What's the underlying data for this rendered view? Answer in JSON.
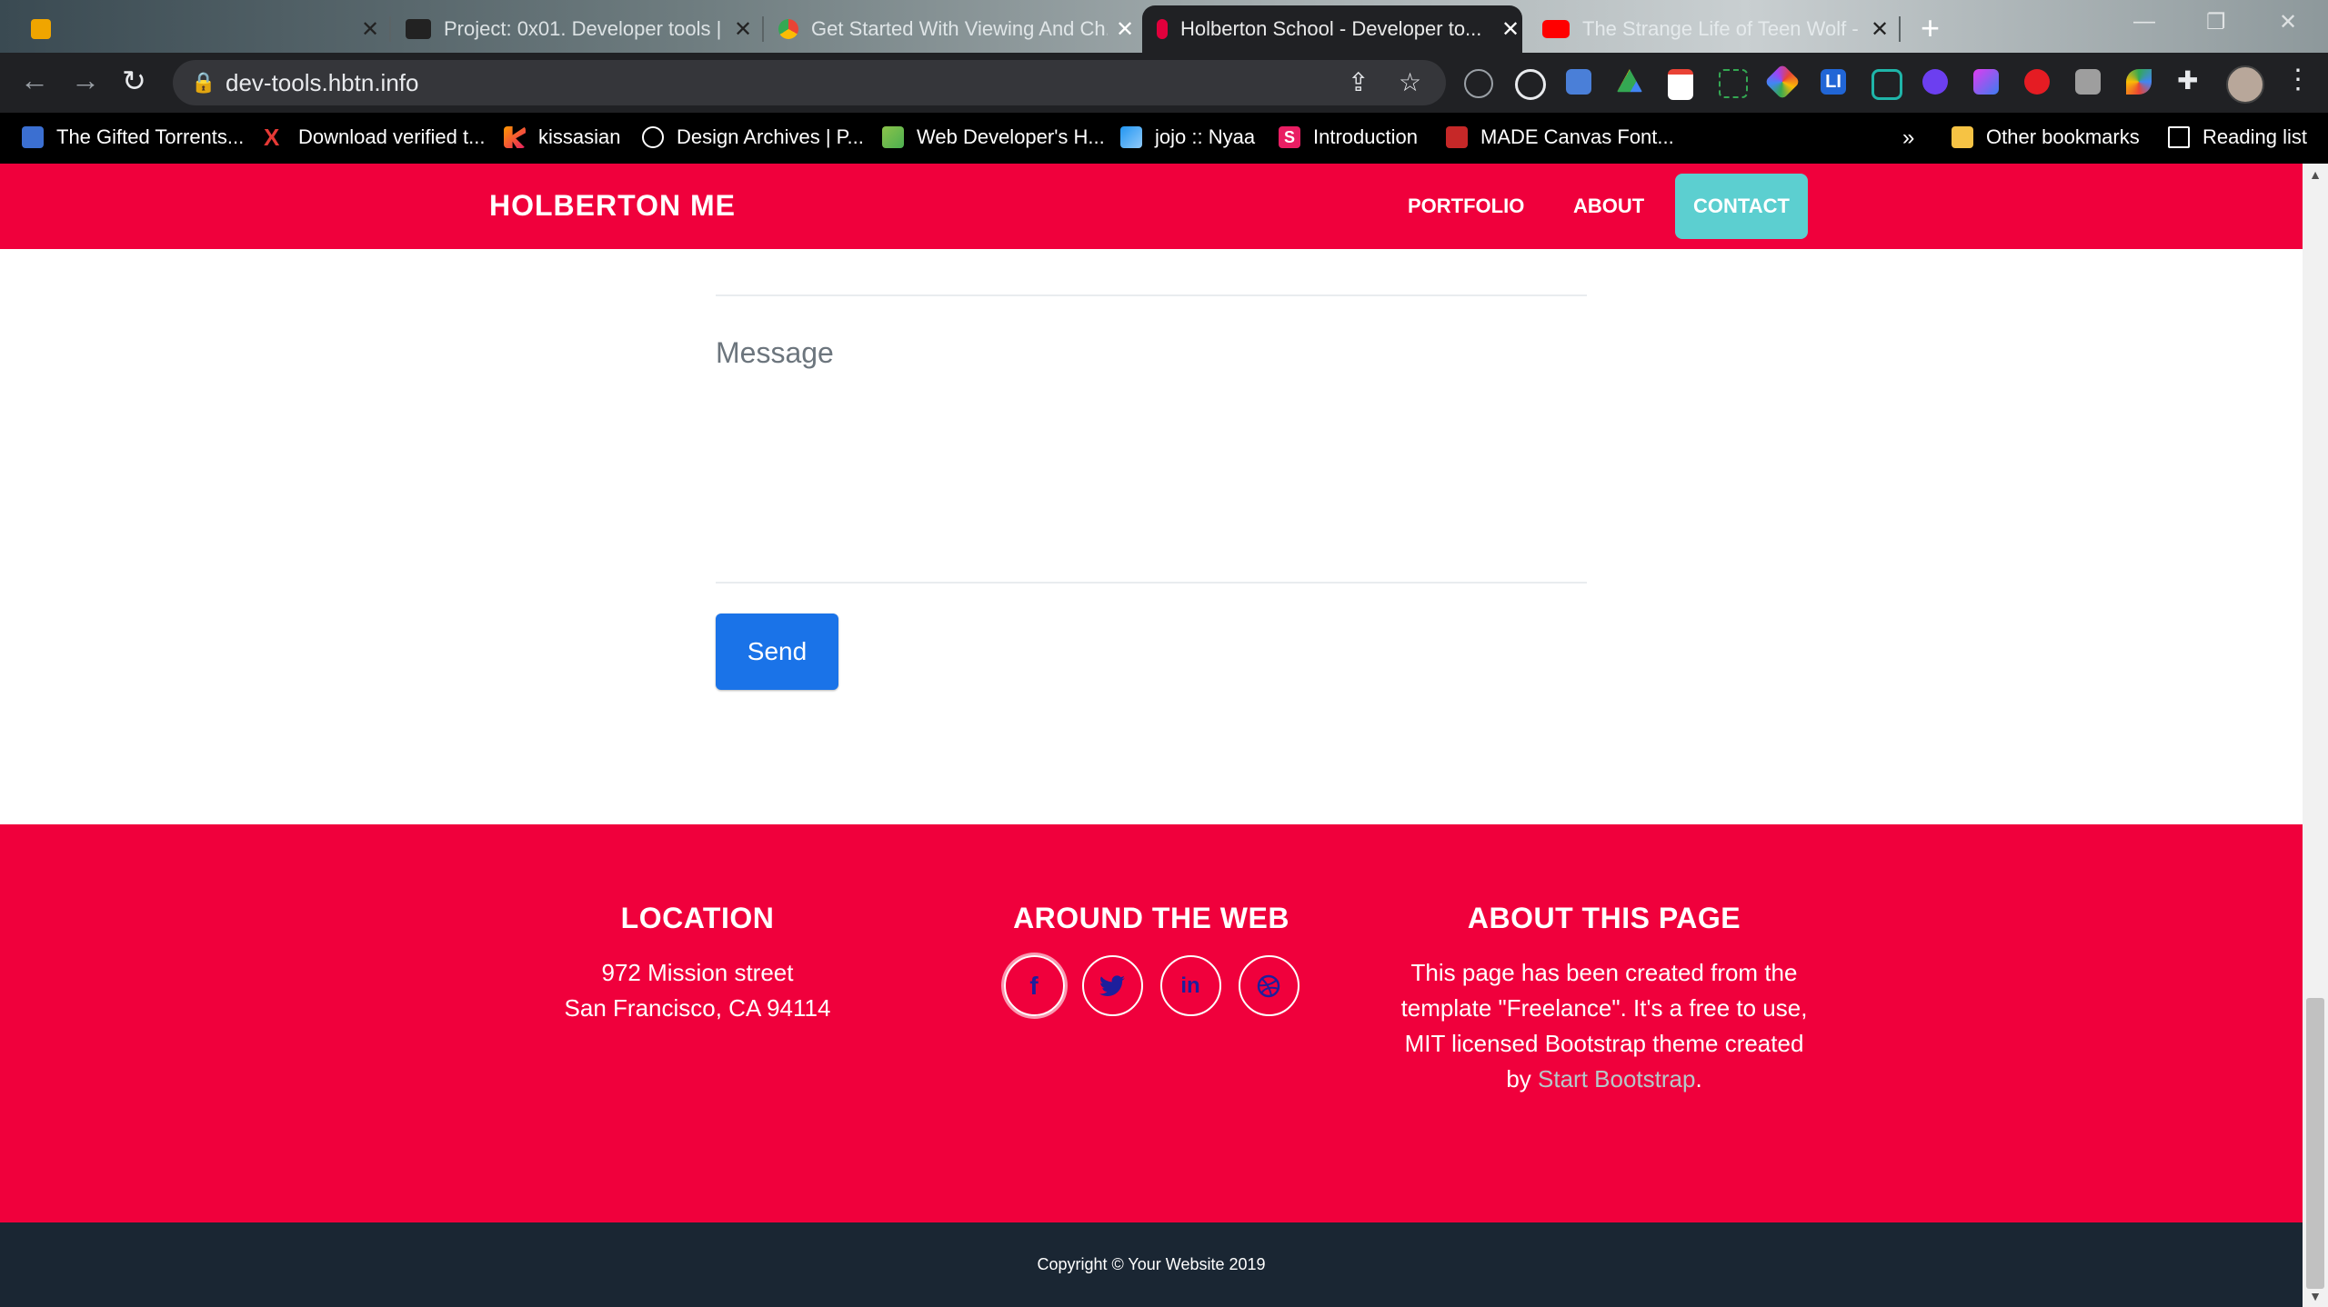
{
  "browser": {
    "tabs": [
      {
        "title": "",
        "favicon_color": "#f0a500"
      },
      {
        "title": "Project: 0x01. Developer tools | ...",
        "favicon_color": "#222"
      },
      {
        "title": "Get Started With Viewing And Ch...",
        "favicon_color": "#4285f4"
      },
      {
        "title": "Holberton School - Developer to...",
        "favicon_color": "#e1003c",
        "active": true
      },
      {
        "title": "The Strange Life of Teen Wolf - Y...",
        "favicon_color": "#ff0000"
      }
    ],
    "new_tab_label": "+",
    "url": "dev-tools.hbtn.info",
    "bookmarks": [
      "The Gifted Torrents...",
      "Download verified t...",
      "kissasian",
      "Design Archives | P...",
      "Web Developer's H...",
      "jojo :: Nyaa",
      "Introduction",
      "MADE Canvas Font..."
    ],
    "bookmarks_overflow": "»",
    "other_bookmarks": "Other bookmarks",
    "reading_list": "Reading list"
  },
  "navbar": {
    "brand": "HOLBERTON ME",
    "links": [
      "PORTFOLIO",
      "ABOUT",
      "CONTACT"
    ],
    "active_link": "CONTACT",
    "accent": "#f0003c",
    "active_bg": "#5ccfd0"
  },
  "form": {
    "message_placeholder": "Message",
    "send_label": "Send",
    "button_color": "#1a73e8"
  },
  "footer": {
    "location_heading": "LOCATION",
    "location_line1": "972 Mission street",
    "location_line2": "San Francisco, CA 94114",
    "web_heading": "AROUND THE WEB",
    "social_icons": [
      "facebook-icon",
      "twitter-icon",
      "linkedin-icon",
      "dribbble-icon"
    ],
    "about_heading": "ABOUT THIS PAGE",
    "about_text": "This page has been created from the template \"Freelance\". It's a free to use, MIT licensed Bootstrap theme created by",
    "about_link": "Start Bootstrap",
    "about_end": ".",
    "copyright": "Copyright © Your Website 2019"
  }
}
